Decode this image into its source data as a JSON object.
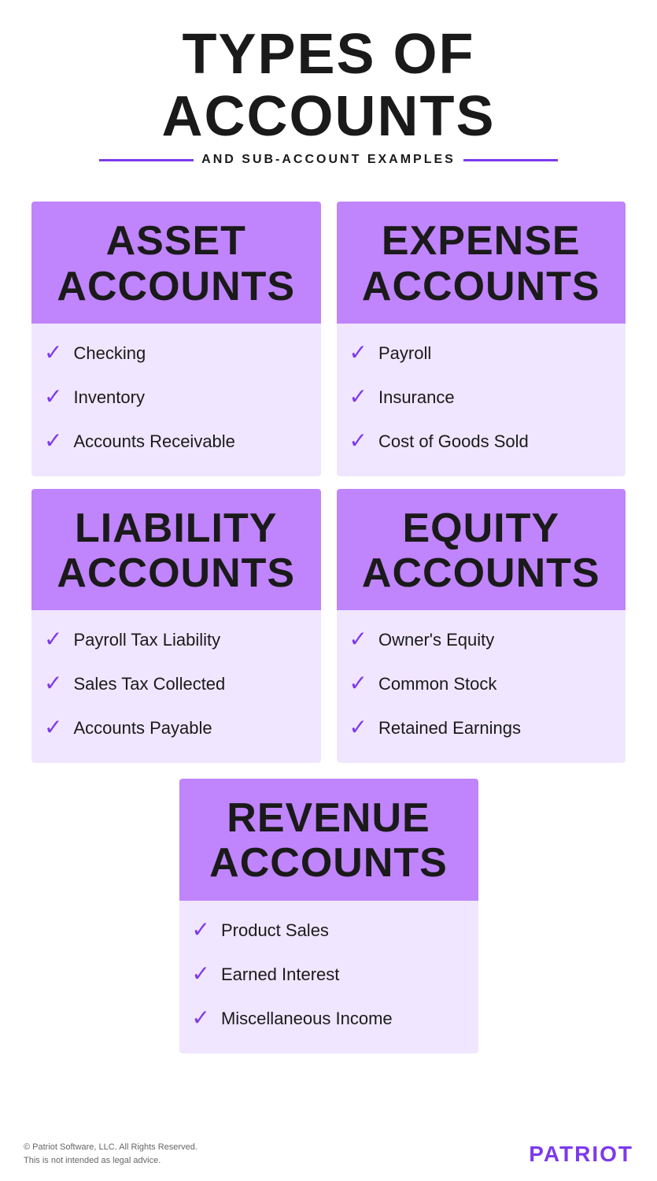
{
  "header": {
    "main_title": "TYPES OF ACCOUNTS",
    "subtitle": "AND SUB-ACCOUNT EXAMPLES"
  },
  "cards": {
    "asset": {
      "title_line1": "ASSET",
      "title_line2": "ACCOUNTS",
      "items": [
        "Checking",
        "Inventory",
        "Accounts Receivable"
      ]
    },
    "expense": {
      "title_line1": "EXPENSE",
      "title_line2": "ACCOUNTS",
      "items": [
        "Payroll",
        "Insurance",
        "Cost of Goods Sold"
      ]
    },
    "liability": {
      "title_line1": "LIABILITY",
      "title_line2": "ACCOUNTS",
      "items": [
        "Payroll Tax Liability",
        "Sales Tax Collected",
        "Accounts Payable"
      ]
    },
    "equity": {
      "title_line1": "EQUITY",
      "title_line2": "ACCOUNTS",
      "items": [
        "Owner's Equity",
        "Common Stock",
        "Retained Earnings"
      ]
    },
    "revenue": {
      "title_line1": "REVENUE",
      "title_line2": "ACCOUNTS",
      "items": [
        "Product Sales",
        "Earned Interest",
        "Miscellaneous Income"
      ]
    }
  },
  "footer": {
    "copyright_line1": "© Patriot Software, LLC. All Rights Reserved.",
    "copyright_line2": "This is not intended as legal advice.",
    "brand": "PATRIOT"
  },
  "checkmark_char": "✓"
}
